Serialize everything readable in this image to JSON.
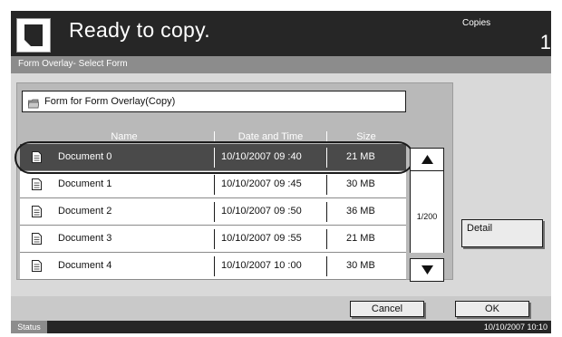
{
  "header": {
    "status_message": "Ready to copy.",
    "copies_label": "Copies",
    "copies_count": "1"
  },
  "title_bar": {
    "text": "Form Overlay- Select Form"
  },
  "folder": {
    "label": "Form for Form Overlay(Copy)"
  },
  "columns": {
    "name": "Name",
    "date": "Date and Time",
    "size": "Size"
  },
  "documents": [
    {
      "name": "Document 0",
      "date": "10/10/2007 09 :40",
      "size": "21  MB",
      "selected": true
    },
    {
      "name": "Document 1",
      "date": "10/10/2007 09 :45",
      "size": "30  MB",
      "selected": false
    },
    {
      "name": "Document 2",
      "date": "10/10/2007 09 :50",
      "size": "36  MB",
      "selected": false
    },
    {
      "name": "Document 3",
      "date": "10/10/2007 09 :55",
      "size": "21  MB",
      "selected": false
    },
    {
      "name": "Document 4",
      "date": "10/10/2007 10 :00",
      "size": "30  MB",
      "selected": false
    }
  ],
  "pagination": {
    "indicator": "1/200"
  },
  "buttons": {
    "detail": "Detail",
    "cancel": "Cancel",
    "ok": "OK"
  },
  "status_bar": {
    "label": "Status",
    "datetime": "10/10/2007   10:10"
  },
  "icons": {
    "document_badge": "document-icon",
    "folder": "folder-icon",
    "row": "file-icon",
    "scroll_up": "triangle-up-icon",
    "scroll_down": "triangle-down-icon"
  },
  "colors": {
    "header_bg": "#262626",
    "title_bar_bg": "#8c8c8c",
    "selected_row_bg": "#4a4a4a"
  }
}
